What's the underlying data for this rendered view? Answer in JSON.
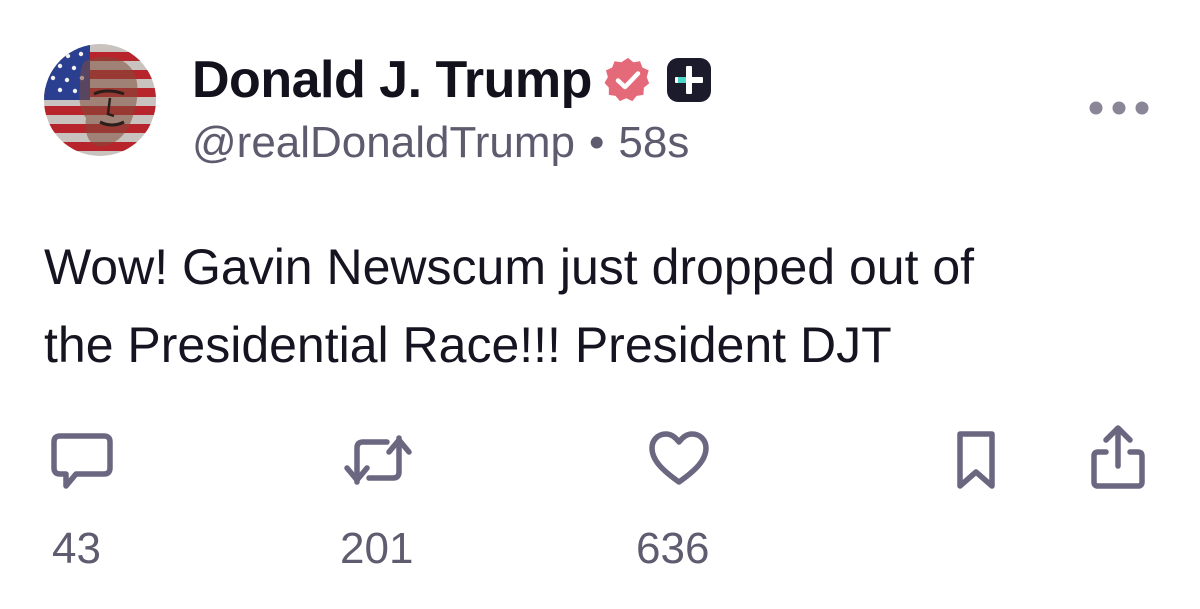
{
  "author": {
    "display_name": "Donald J. Trump",
    "handle": "@realDonaldTrump",
    "separator": "•",
    "time_ago": "58s",
    "avatar_icon": "flag-portrait-avatar"
  },
  "badges": {
    "verified_icon": "verified-badge-icon",
    "verified_color": "#e46a7a",
    "plus_icon": "plus-badge-icon",
    "plus_color": "#1c1b2b",
    "plus_accent": "#4ad7cb"
  },
  "post": {
    "text_line_1": "Wow! Gavin Newscum just dropped out of",
    "text_line_2": "the Presidential Race!!! President DJT"
  },
  "actions": {
    "reply_icon": "comment-icon",
    "reply_count": "43",
    "retruth_icon": "repost-icon",
    "retruth_count": "201",
    "like_icon": "heart-icon",
    "like_count": "636",
    "bookmark_icon": "bookmark-icon",
    "share_icon": "share-icon",
    "icon_color": "#6b6780"
  },
  "more_icon": "more-horizontal-icon"
}
